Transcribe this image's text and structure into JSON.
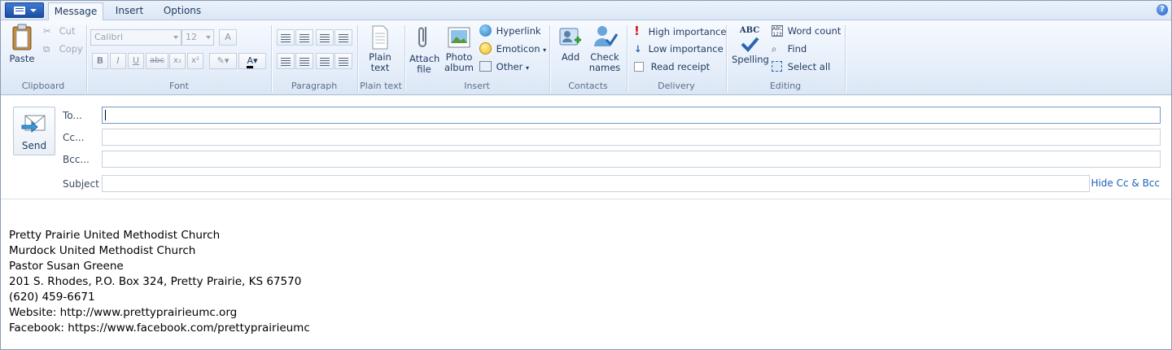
{
  "tabs": [
    "Message",
    "Insert",
    "Options"
  ],
  "ribbon": {
    "clipboard": {
      "paste": "Paste",
      "cut": "Cut",
      "copy": "Copy",
      "group": "Clipboard"
    },
    "font": {
      "family": "Calibri",
      "size": "12",
      "group": "Font"
    },
    "paragraph": {
      "group": "Paragraph"
    },
    "plain_text": {
      "button_line1": "Plain",
      "button_line2": "text",
      "group": "Plain text"
    },
    "insert": {
      "attach_line1": "Attach",
      "attach_line2": "file",
      "photo_line1": "Photo",
      "photo_line2": "album",
      "hyperlink": "Hyperlink",
      "emoticon": "Emoticon",
      "other": "Other",
      "group": "Insert"
    },
    "contacts": {
      "add": "Add",
      "check_line1": "Check",
      "check_line2": "names",
      "group": "Contacts"
    },
    "delivery": {
      "high": "High importance",
      "low": "Low importance",
      "receipt": "Read receipt",
      "group": "Delivery"
    },
    "editing": {
      "spelling_abc": "ABC",
      "spelling": "Spelling",
      "word_count": "Word count",
      "find": "Find",
      "select_all": "Select all",
      "group": "Editing"
    }
  },
  "compose": {
    "send": "Send",
    "to_label": "To...",
    "cc_label": "Cc...",
    "bcc_label": "Bcc...",
    "subject_label": "Subject",
    "to_value": "",
    "cc_value": "",
    "bcc_value": "",
    "subject_value": "",
    "hide_cc_bcc": "Hide Cc & Bcc"
  },
  "body_lines": [
    "Pretty Prairie United Methodist Church",
    "Murdock United Methodist Church",
    "Pastor Susan Greene",
    "201 S. Rhodes, P.O. Box 324, Pretty Prairie, KS 67570",
    "(620) 459-6671",
    "Website: http://www.prettyprairieumc.org",
    "Facebook: https://www.facebook.com/prettyprairieumc"
  ]
}
